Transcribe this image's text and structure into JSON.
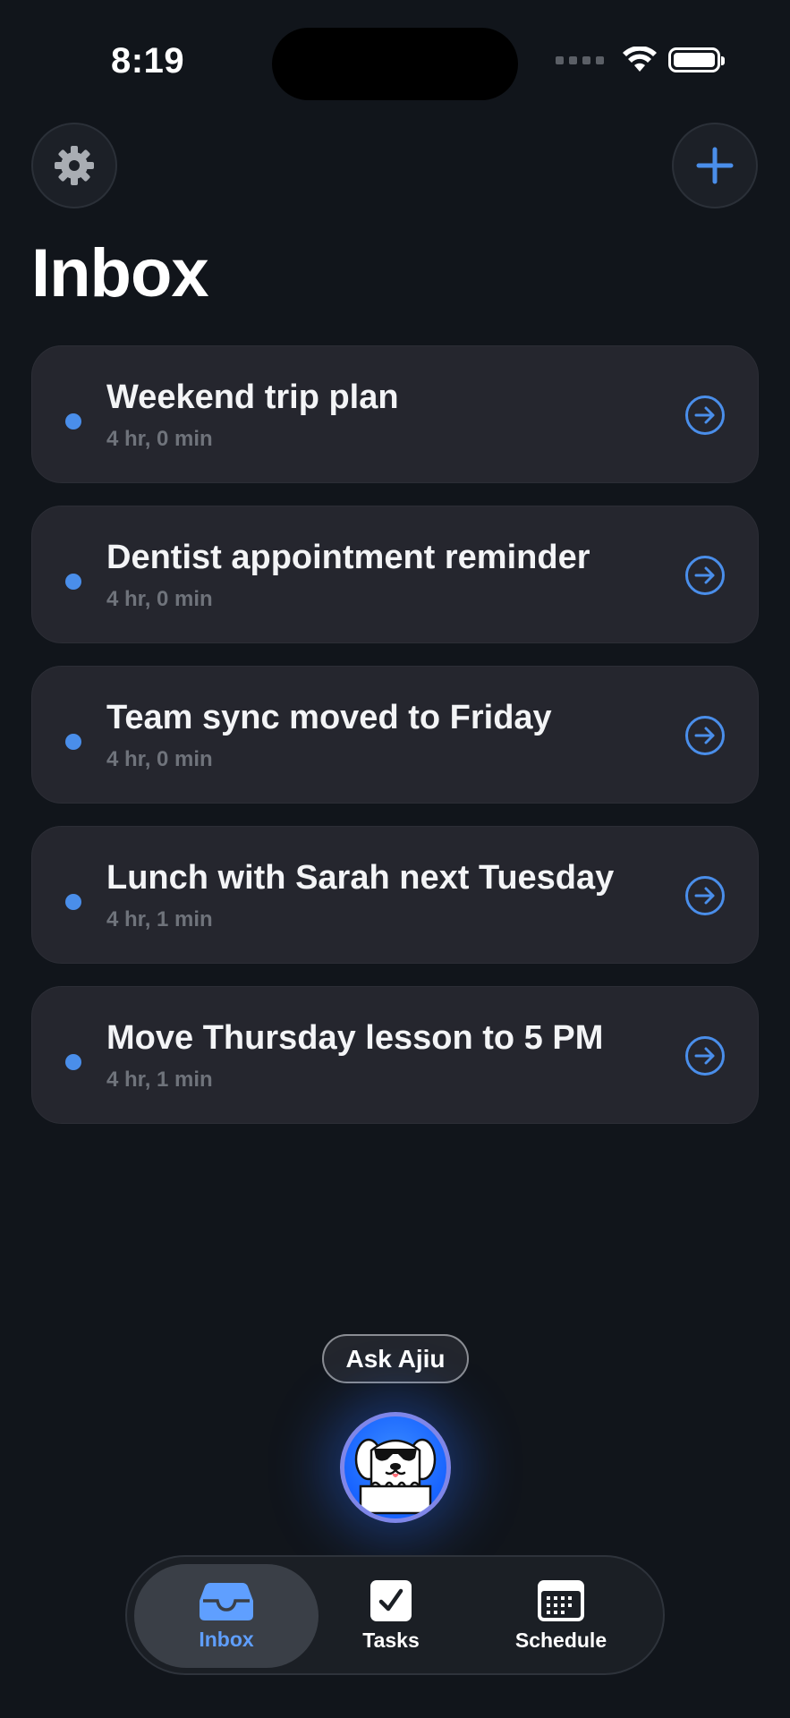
{
  "status_bar": {
    "time": "8:19"
  },
  "header": {
    "title": "Inbox",
    "settings_icon": "gear-icon",
    "add_icon": "plus-icon"
  },
  "colors": {
    "accent": "#4a8eea",
    "background": "#11151b",
    "card": "#25262e",
    "active_tab_label": "#5f9fff"
  },
  "inbox": {
    "items": [
      {
        "title": "Weekend trip plan",
        "meta": "4 hr, 0 min"
      },
      {
        "title": "Dentist appointment reminder",
        "meta": "4 hr, 0 min"
      },
      {
        "title": "Team sync moved to Friday",
        "meta": "4 hr, 0 min"
      },
      {
        "title": "Lunch with Sarah next Tuesday",
        "meta": "4 hr, 1 min"
      },
      {
        "title": "Move Thursday lesson to 5 PM",
        "meta": "4 hr, 1 min"
      }
    ]
  },
  "assistant": {
    "label": "Ask Ajiu",
    "icon": "dog-mascot-icon"
  },
  "tabs": [
    {
      "label": "Inbox",
      "icon": "inbox-tray-icon",
      "active": true
    },
    {
      "label": "Tasks",
      "icon": "checkbox-icon",
      "active": false
    },
    {
      "label": "Schedule",
      "icon": "calendar-icon",
      "active": false
    }
  ]
}
